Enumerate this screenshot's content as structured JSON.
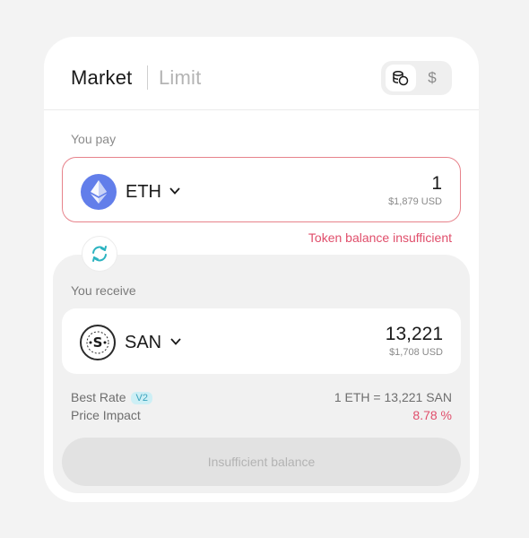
{
  "tabs": {
    "market_label": "Market",
    "limit_label": "Limit",
    "active": "Market"
  },
  "display_toggle": {
    "options": [
      {
        "icon": "coins-icon",
        "selected": true
      },
      {
        "label": "$",
        "selected": false
      }
    ]
  },
  "pay": {
    "label": "You pay",
    "token": "ETH",
    "token_icon": "ethereum-icon",
    "amount": "1",
    "amount_usd": "$1,879 USD",
    "error": "Token balance insufficient"
  },
  "receive": {
    "label": "You receive",
    "token": "SAN",
    "token_icon": "san-token-icon",
    "amount": "13,221",
    "amount_usd": "$1,708 USD"
  },
  "details": {
    "best_rate_label": "Best Rate",
    "best_rate_badge": "V2",
    "best_rate_value": "1 ETH = 13,221 SAN",
    "price_impact_label": "Price Impact",
    "price_impact_value": "8.78 %"
  },
  "action": {
    "label": "Insufficient balance",
    "enabled": false
  },
  "colors": {
    "accent_error": "#e04e6b",
    "swap_icon": "#2bb3c0",
    "eth_brand": "#627eea",
    "badge_bg": "#cdeff5"
  }
}
